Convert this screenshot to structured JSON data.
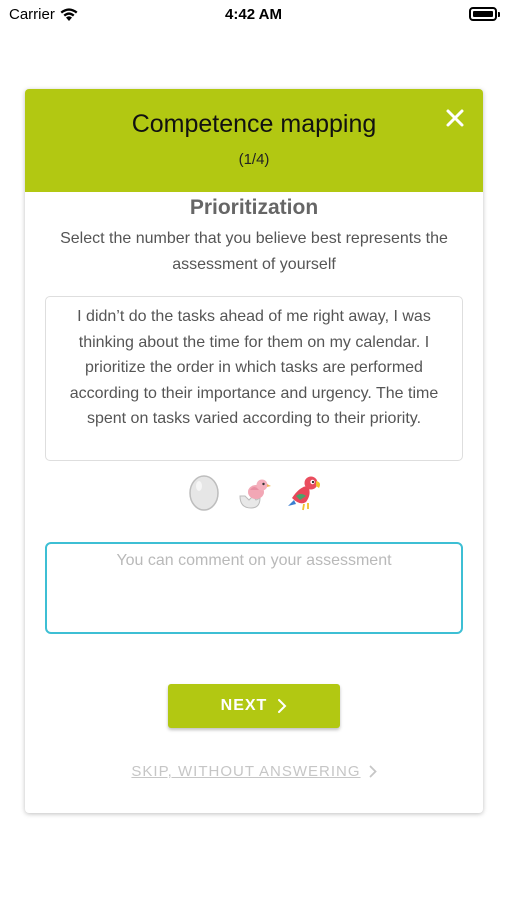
{
  "status_bar": {
    "carrier": "Carrier",
    "time": "4:42 AM"
  },
  "header": {
    "title": "Competence mapping",
    "step": "(1/4)",
    "close_icon": "close-icon",
    "background_color": "#b2c812"
  },
  "section": {
    "title": "Prioritization",
    "subtitle": "Select the number that you believe best represents the assessment of yourself"
  },
  "statement": "I didn’t do the tasks ahead of me right away, I was thinking about the time for them on my calendar. I prioritize the order in which tasks are performed according to their importance and urgency. The time spent on tasks varied according to their priority.",
  "rating_options": [
    {
      "icon": "egg-icon"
    },
    {
      "icon": "hatching-bird-icon"
    },
    {
      "icon": "parrot-icon"
    }
  ],
  "comment": {
    "placeholder": "You can comment on your assessment",
    "value": "",
    "border_color": "#3dbfd4"
  },
  "next_button": {
    "label": "NEXT",
    "icon": "chevron-right-icon"
  },
  "skip_link": {
    "label": "SKIP, WITHOUT ANSWERING",
    "icon": "chevron-right-icon"
  }
}
